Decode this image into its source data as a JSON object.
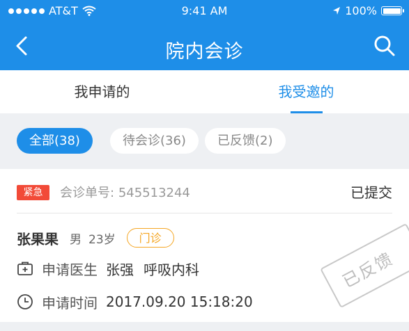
{
  "status_bar": {
    "carrier": "AT&T",
    "time": "9:41 AM",
    "battery": "100%",
    "battery_level": 1.0
  },
  "nav": {
    "title": "院内会诊"
  },
  "tabs": [
    {
      "label": "我申请的",
      "active": false
    },
    {
      "label": "我受邀的",
      "active": true
    }
  ],
  "filters": [
    {
      "label": "全部(38)",
      "active": true
    },
    {
      "label": "待会诊(36)",
      "active": false
    },
    {
      "label": "已反馈(2)",
      "active": false
    }
  ],
  "card": {
    "urgent_badge": "紧急",
    "order_label": "会诊单号:",
    "order_no": "545513244",
    "status": "已提交",
    "patient": {
      "name": "张果果",
      "gender": "男",
      "age": "23岁",
      "type": "门诊"
    },
    "doctor_label": "申请医生",
    "doctor_name": "张强",
    "department": "呼吸内科",
    "time_label": "申请时间",
    "time_value": "2017.09.20 15:18:20",
    "stamp": "已反馈"
  },
  "colors": {
    "primary": "#1e8ee8",
    "urgent": "#f24a38",
    "clinic": "#f5a623"
  }
}
